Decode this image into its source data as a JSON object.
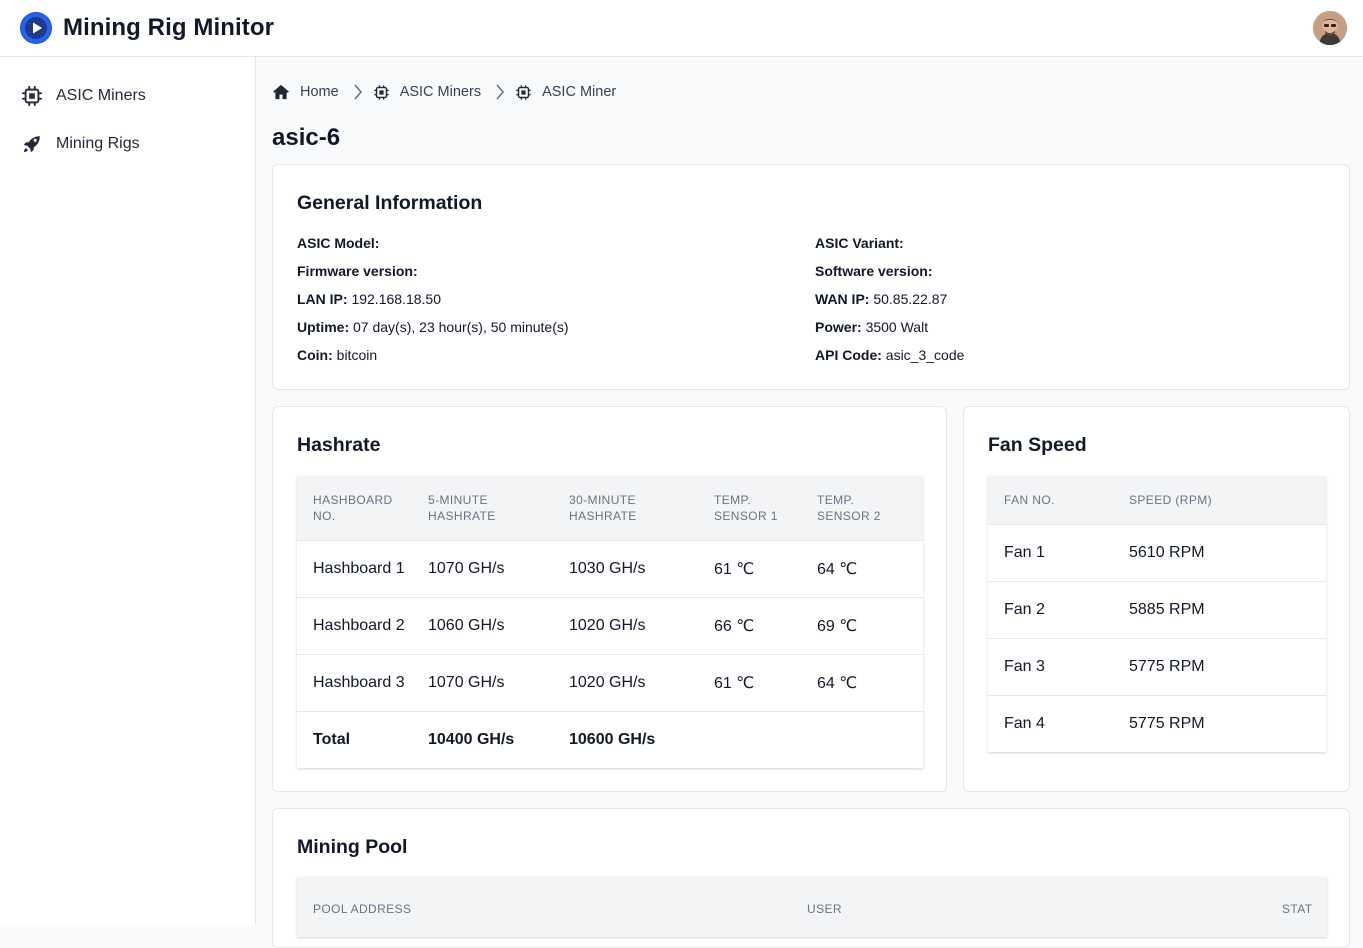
{
  "app": {
    "title": "Mining Rig Minitor"
  },
  "sidebar": {
    "items": [
      {
        "label": "ASIC Miners",
        "icon": "chip-icon"
      },
      {
        "label": "Mining Rigs",
        "icon": "rocket-icon"
      }
    ]
  },
  "breadcrumb": {
    "items": [
      {
        "label": "Home",
        "icon": "home-icon"
      },
      {
        "label": "ASIC Miners",
        "icon": "chip-icon"
      },
      {
        "label": "ASIC Miner",
        "icon": "chip-icon"
      }
    ]
  },
  "page": {
    "title": "asic-6"
  },
  "general": {
    "title": "General Information",
    "left": [
      {
        "label": "ASIC Model:",
        "value": ""
      },
      {
        "label": "Firmware version:",
        "value": ""
      },
      {
        "label": "LAN IP:",
        "value": "192.168.18.50"
      },
      {
        "label": "Uptime:",
        "value": "07 day(s), 23 hour(s), 50 minute(s)"
      },
      {
        "label": "Coin:",
        "value": "bitcoin"
      }
    ],
    "right": [
      {
        "label": "ASIC Variant:",
        "value": ""
      },
      {
        "label": "Software version:",
        "value": ""
      },
      {
        "label": "WAN IP:",
        "value": "50.85.22.87"
      },
      {
        "label": "Power:",
        "value": "3500 Walt"
      },
      {
        "label": "API Code:",
        "value": "asic_3_code"
      }
    ]
  },
  "hashrate": {
    "title": "Hashrate",
    "headers": [
      "Hashboard No.",
      "5-Minute Hashrate",
      "30-Minute Hashrate",
      "Temp. Sensor 1",
      "Temp. Sensor 2"
    ],
    "rows": [
      [
        "Hashboard 1",
        "1070 GH/s",
        "1030 GH/s",
        "61 ℃",
        "64 ℃"
      ],
      [
        "Hashboard 2",
        "1060 GH/s",
        "1020 GH/s",
        "66 ℃",
        "69 ℃"
      ],
      [
        "Hashboard 3",
        "1070 GH/s",
        "1020 GH/s",
        "61 ℃",
        "64 ℃"
      ]
    ],
    "total": [
      "Total",
      "10400 GH/s",
      "10600 GH/s",
      "",
      ""
    ]
  },
  "fan": {
    "title": "Fan Speed",
    "headers": [
      "Fan No.",
      "Speed (RPM)"
    ],
    "rows": [
      [
        "Fan 1",
        "5610 RPM"
      ],
      [
        "Fan 2",
        "5885 RPM"
      ],
      [
        "Fan 3",
        "5775 RPM"
      ],
      [
        "Fan 4",
        "5775 RPM"
      ]
    ]
  },
  "pool": {
    "title": "Mining Pool",
    "headers": [
      "Pool Address",
      "User",
      "Stat"
    ]
  },
  "colors": {
    "brand": "#1d4ed8",
    "border": "#e5e7eb",
    "header_bg": "#f3f4f6"
  }
}
